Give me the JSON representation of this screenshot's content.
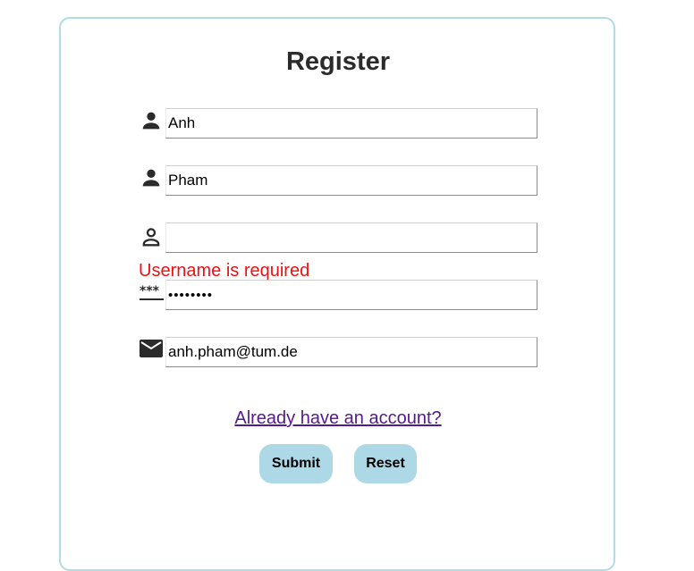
{
  "form": {
    "title": "Register",
    "first_name": {
      "value": "Anh",
      "icon": "person-icon"
    },
    "last_name": {
      "value": "Pham",
      "icon": "person-icon"
    },
    "username": {
      "value": "",
      "icon": "person-outline-icon"
    },
    "username_error": "Username is required",
    "password": {
      "value": "••••••••",
      "icon": "password-icon"
    },
    "email": {
      "value": "anh.pham@tum.de",
      "icon": "mail-icon"
    },
    "login_link": "Already have an account?",
    "submit_label": "Submit",
    "reset_label": "Reset"
  },
  "colors": {
    "card_border": "#b0dce6",
    "button_bg": "#add8e6",
    "error": "#ee1111",
    "link": "#551a8b"
  }
}
